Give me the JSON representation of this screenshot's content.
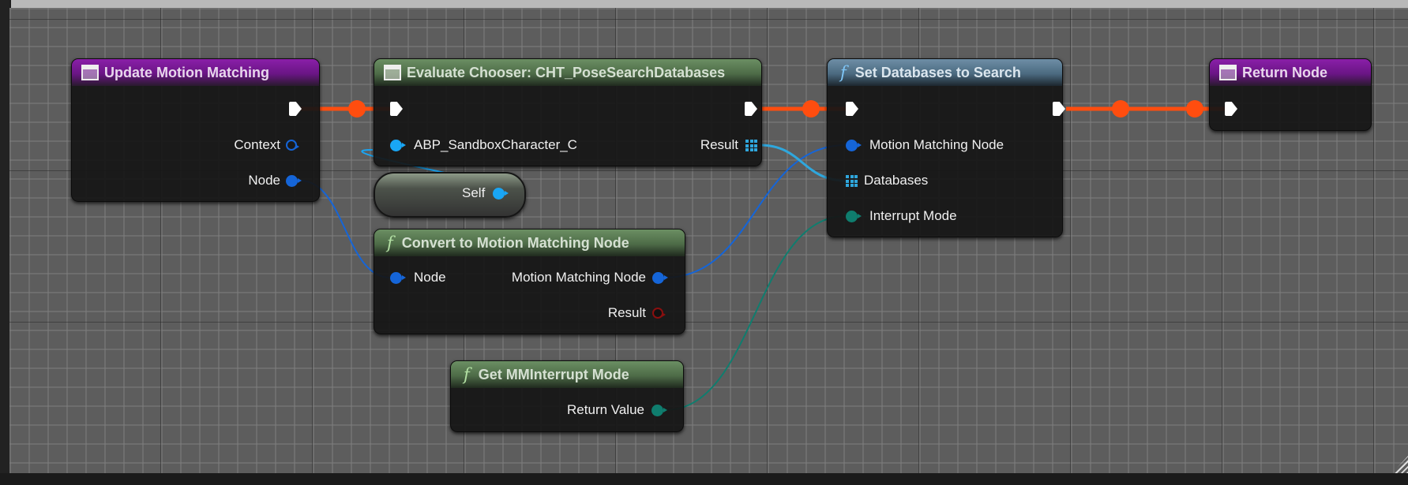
{
  "graph": {
    "nodes": {
      "update_motion_matching": {
        "title": "Update Motion Matching",
        "icon": "event-icon",
        "pins": {
          "context": "Context",
          "node": "Node"
        }
      },
      "evaluate_chooser": {
        "title": "Evaluate Chooser: CHT_PoseSearchDatabases",
        "icon": "event-icon",
        "pins": {
          "context_object": "ABP_SandboxCharacter_C",
          "result": "Result"
        }
      },
      "self": {
        "label": "Self"
      },
      "convert_to_mm_node": {
        "title": "Convert to Motion Matching Node",
        "icon": "function-icon",
        "pins": {
          "node": "Node",
          "motion_matching_node": "Motion Matching Node",
          "result": "Result"
        }
      },
      "get_mm_interrupt_mode": {
        "title": "Get MMInterrupt Mode",
        "icon": "function-icon",
        "pins": {
          "return_value": "Return Value"
        }
      },
      "set_databases_to_search": {
        "title": "Set Databases to Search",
        "icon": "function-icon",
        "pins": {
          "motion_matching_node": "Motion Matching Node",
          "databases": "Databases",
          "interrupt_mode": "Interrupt Mode"
        }
      },
      "return_node": {
        "title": "Return Node",
        "icon": "event-icon"
      }
    },
    "colors": {
      "exec_wire": "#ff4d0f",
      "object_pin": "#19a6f5",
      "struct_pin": "#1565d8",
      "array_pin": "#2fa7dd",
      "enum_pin": "#0f7d6e",
      "bool_pin": "#8a0f0f"
    }
  }
}
